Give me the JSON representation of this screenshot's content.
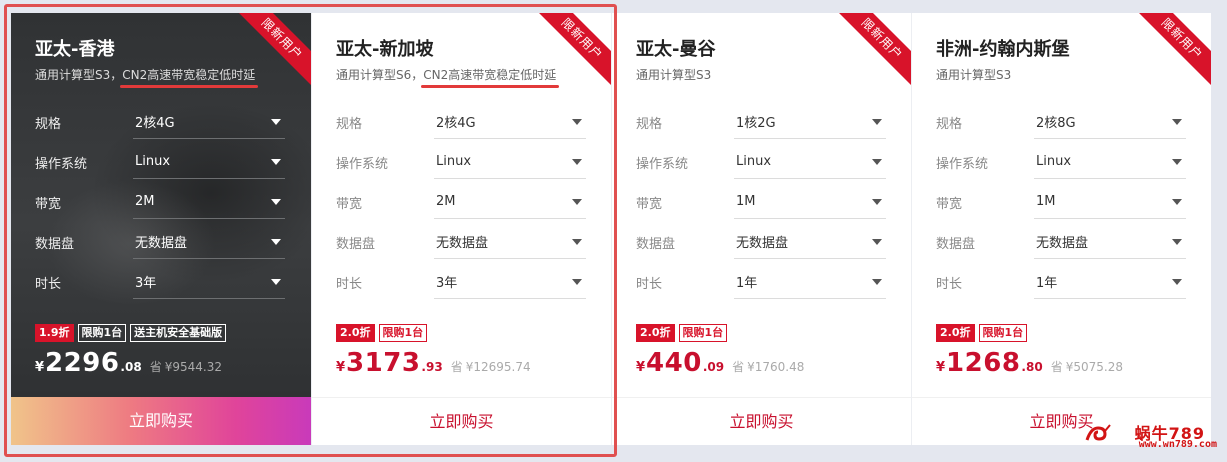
{
  "cards": [
    {
      "ribbon": "限新用户",
      "title": "亚太-香港",
      "subtitle_prefix": "通用计算型S3，",
      "subtitle_highlight": "CN2高速带宽稳定低时延",
      "specs": [
        {
          "label": "规格",
          "value": "2核4G"
        },
        {
          "label": "操作系统",
          "value": "Linux"
        },
        {
          "label": "带宽",
          "value": "2M"
        },
        {
          "label": "数据盘",
          "value": "无数据盘"
        },
        {
          "label": "时长",
          "value": "3年"
        }
      ],
      "badges": [
        "1.9折",
        "限购1台",
        "送主机安全基础版"
      ],
      "currency": "¥",
      "price_int": "2296",
      "price_dec": ".08",
      "orig_prefix": "省",
      "orig_price": "¥9544.32",
      "buy_label": "立即购买"
    },
    {
      "ribbon": "限新用户",
      "title": "亚太-新加坡",
      "subtitle_prefix": "通用计算型S6，",
      "subtitle_highlight": "CN2高速带宽稳定低时延",
      "specs": [
        {
          "label": "规格",
          "value": "2核4G"
        },
        {
          "label": "操作系统",
          "value": "Linux"
        },
        {
          "label": "带宽",
          "value": "2M"
        },
        {
          "label": "数据盘",
          "value": "无数据盘"
        },
        {
          "label": "时长",
          "value": "3年"
        }
      ],
      "badges": [
        "2.0折",
        "限购1台"
      ],
      "currency": "¥",
      "price_int": "3173",
      "price_dec": ".93",
      "orig_prefix": "省",
      "orig_price": "¥12695.74",
      "buy_label": "立即购买"
    },
    {
      "ribbon": "限新用户",
      "title": "亚太-曼谷",
      "subtitle_prefix": "通用计算型S3",
      "subtitle_highlight": "",
      "specs": [
        {
          "label": "规格",
          "value": "1核2G"
        },
        {
          "label": "操作系统",
          "value": "Linux"
        },
        {
          "label": "带宽",
          "value": "1M"
        },
        {
          "label": "数据盘",
          "value": "无数据盘"
        },
        {
          "label": "时长",
          "value": "1年"
        }
      ],
      "badges": [
        "2.0折",
        "限购1台"
      ],
      "currency": "¥",
      "price_int": "440",
      "price_dec": ".09",
      "orig_prefix": "省",
      "orig_price": "¥1760.48",
      "buy_label": "立即购买"
    },
    {
      "ribbon": "限新用户",
      "title": "非洲-约翰内斯堡",
      "subtitle_prefix": "通用计算型S3",
      "subtitle_highlight": "",
      "specs": [
        {
          "label": "规格",
          "value": "2核8G"
        },
        {
          "label": "操作系统",
          "value": "Linux"
        },
        {
          "label": "带宽",
          "value": "1M"
        },
        {
          "label": "数据盘",
          "value": "无数据盘"
        },
        {
          "label": "时长",
          "value": "1年"
        }
      ],
      "badges": [
        "2.0折",
        "限购1台"
      ],
      "currency": "¥",
      "price_int": "1268",
      "price_dec": ".80",
      "orig_prefix": "省",
      "orig_price": "¥5075.28",
      "buy_label": "立即购买"
    }
  ],
  "watermark": {
    "top": "蜗牛789",
    "bottom": "www.wn789.com"
  },
  "colors": {
    "accent_red": "#d8132a",
    "price_red": "#c8102e",
    "highlight_frame": "#e05050",
    "dark_card": "#343638"
  }
}
